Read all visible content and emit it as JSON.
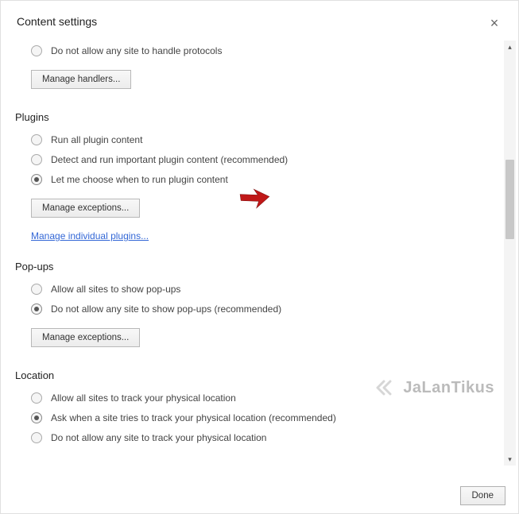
{
  "header": {
    "title": "Content settings",
    "close_glyph": "×"
  },
  "protocols_section": {
    "opt1": "Do not allow any site to handle protocols",
    "manage_btn": "Manage handlers..."
  },
  "plugins_section": {
    "title": "Plugins",
    "opt1": "Run all plugin content",
    "opt2": "Detect and run important plugin content (recommended)",
    "opt3": "Let me choose when to run plugin content",
    "manage_btn": "Manage exceptions...",
    "link": "Manage individual plugins..."
  },
  "popups_section": {
    "title": "Pop-ups",
    "opt1": "Allow all sites to show pop-ups",
    "opt2": "Do not allow any site to show pop-ups (recommended)",
    "manage_btn": "Manage exceptions..."
  },
  "location_section": {
    "title": "Location",
    "opt1": "Allow all sites to track your physical location",
    "opt2": "Ask when a site tries to track your physical location (recommended)",
    "opt3": "Do not allow any site to track your physical location"
  },
  "footer": {
    "done": "Done"
  },
  "watermark": "JaLanTikus"
}
